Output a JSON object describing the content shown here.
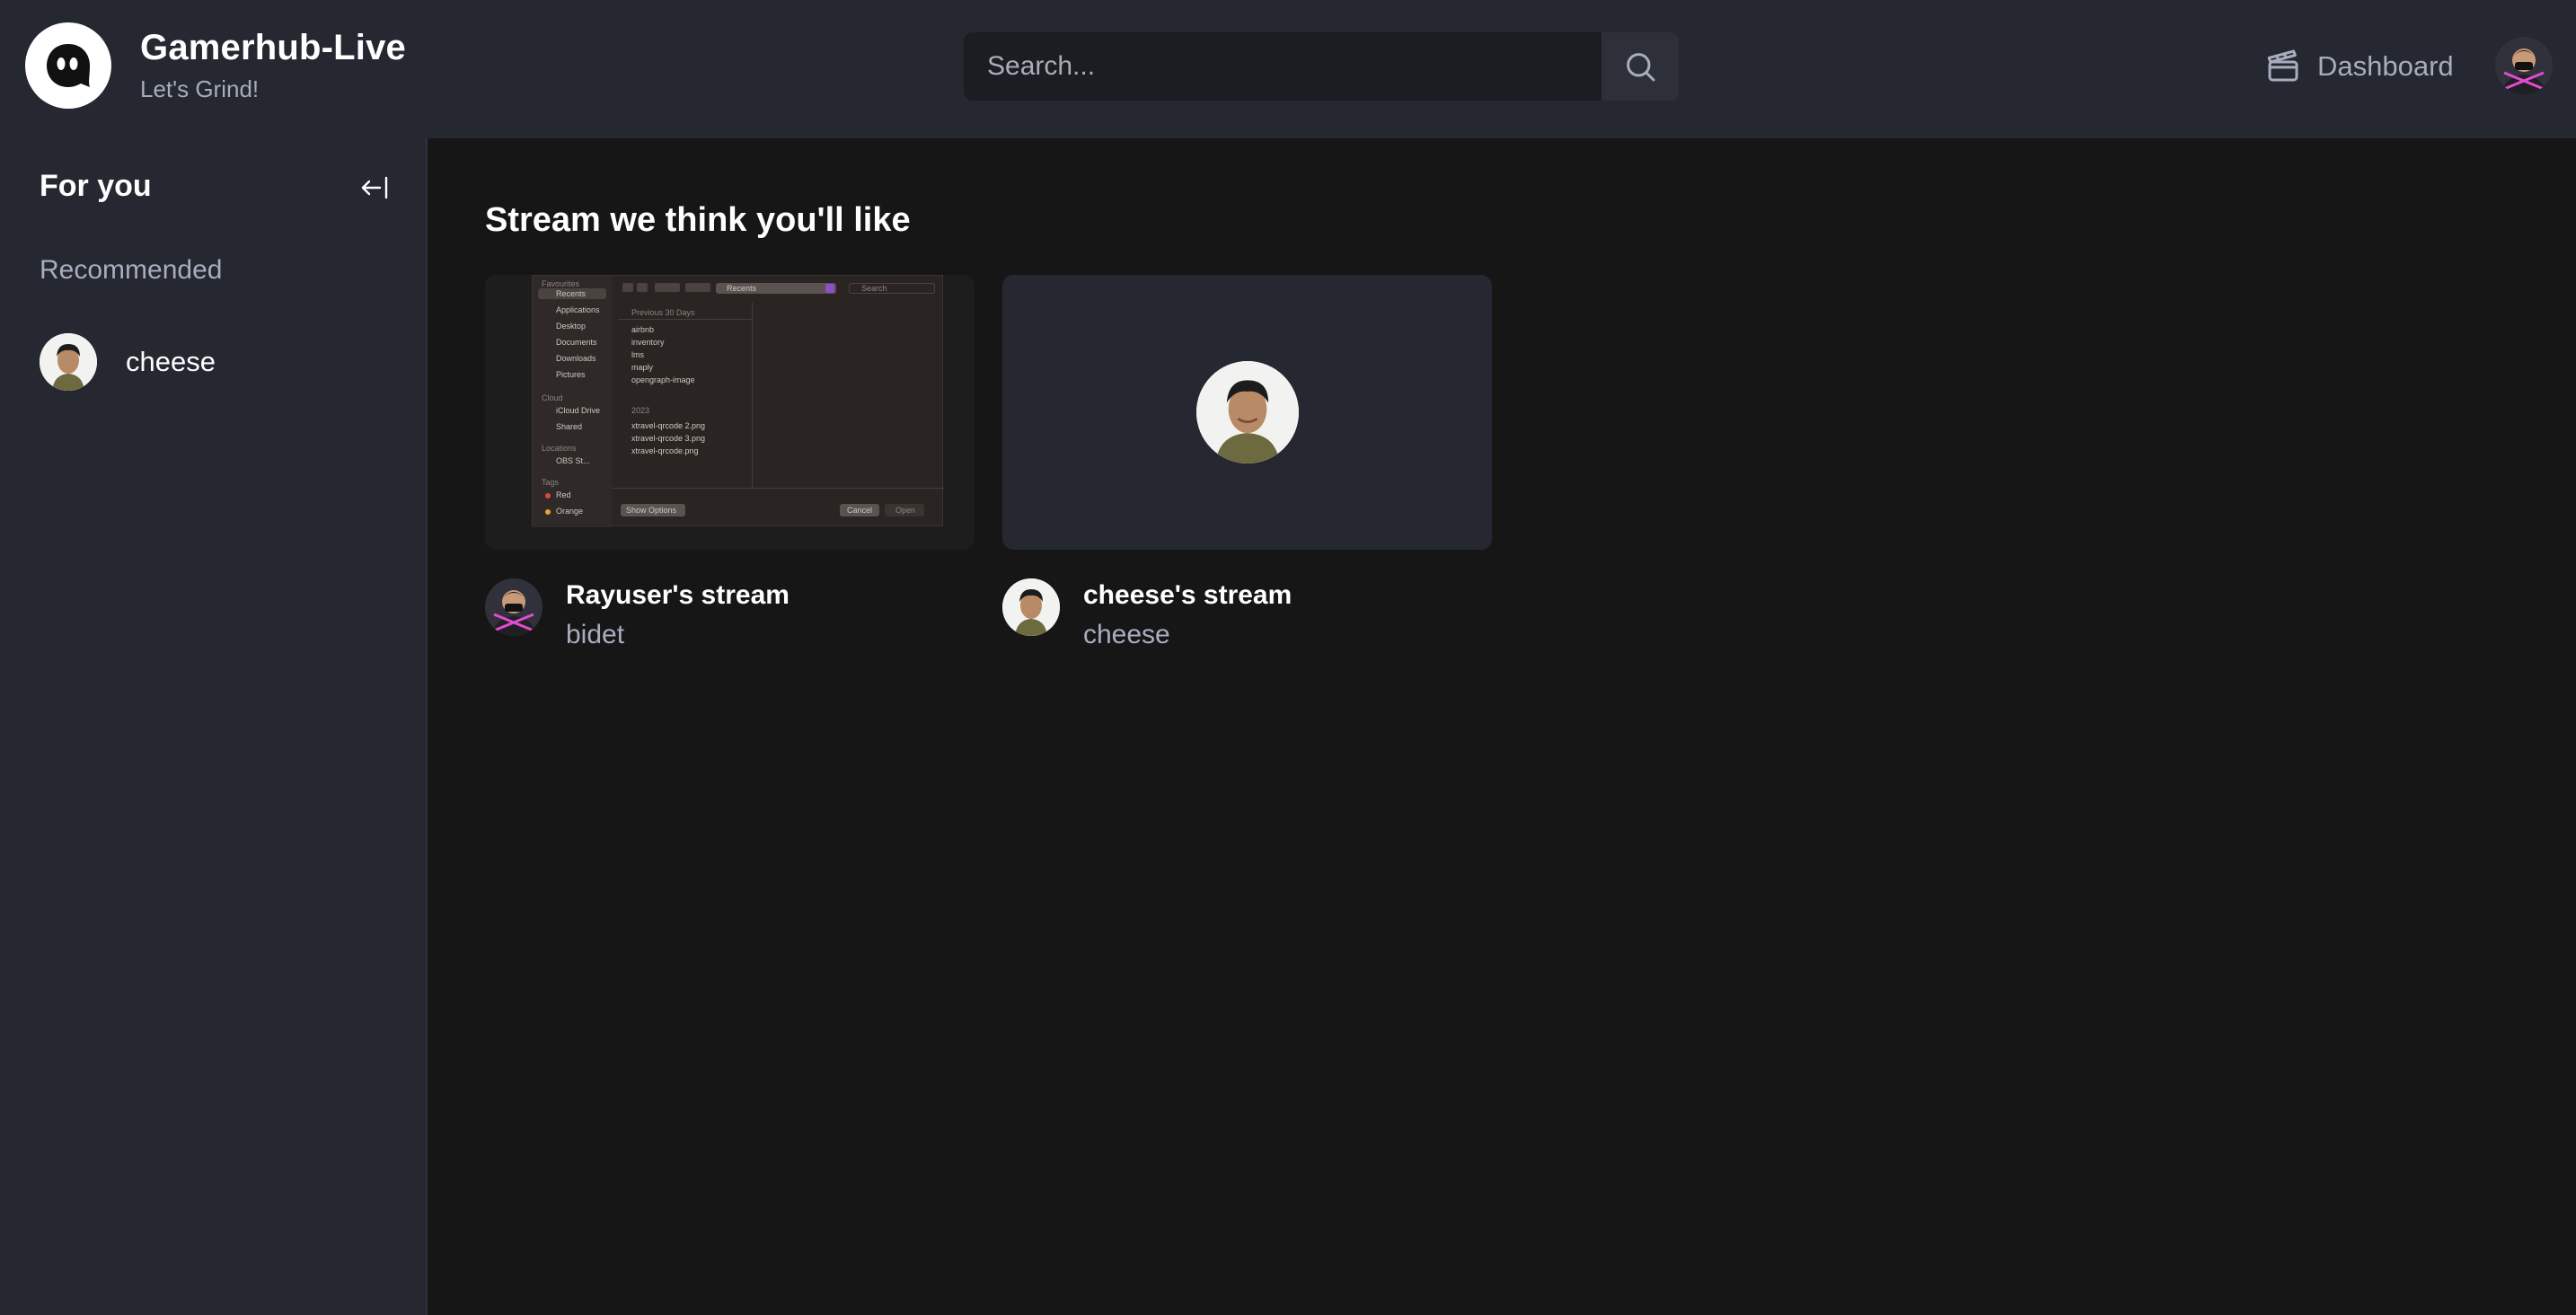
{
  "brand": {
    "title": "Gamerhub-Live",
    "subtitle": "Let's Grind!"
  },
  "search": {
    "placeholder": "Search..."
  },
  "nav": {
    "dashboard_label": "Dashboard"
  },
  "sidebar": {
    "heading": "For you",
    "section_label": "Recommended",
    "items": [
      {
        "label": "cheese"
      }
    ]
  },
  "main": {
    "title": "Stream we think you'll like",
    "cards": [
      {
        "title": "Rayuser's stream",
        "user": "bidet"
      },
      {
        "title": "cheese's stream",
        "user": "cheese"
      }
    ]
  },
  "thumbnail_screen": {
    "side": [
      "Favourites",
      "Recents",
      "Applications",
      "Desktop",
      "Documents",
      "Downloads",
      "Pictures",
      "Cloud",
      "iCloud Drive",
      "Shared",
      "Locations",
      "OBS St...",
      "Tags",
      "Red",
      "Orange"
    ],
    "location": "Recents",
    "search": "Search",
    "group1": "Previous 30 Days",
    "files1": [
      "airbnb",
      "inventory",
      "lms",
      "maply",
      "opengraph-image"
    ],
    "group2": "2023",
    "files2": [
      "xtravel-qrcode 2.png",
      "xtravel-qrcode 3.png",
      "xtravel-qrcode.png"
    ],
    "show_options": "Show Options",
    "cancel": "Cancel",
    "open": "Open"
  },
  "colors": {
    "navbar_bg": "#252731",
    "page_bg": "#161616",
    "muted_text": "#a7adbd",
    "accent_pink": "#e24bd0"
  }
}
